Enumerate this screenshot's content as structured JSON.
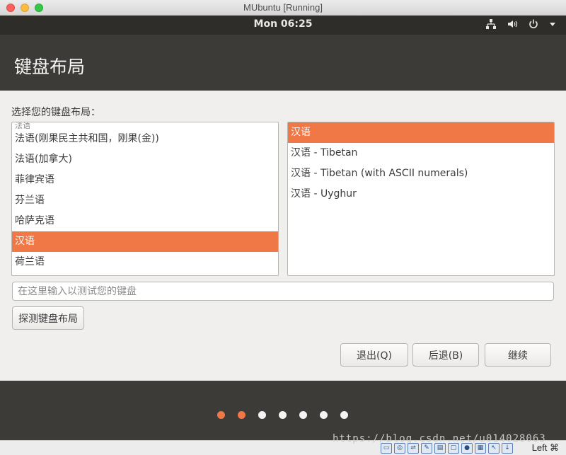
{
  "window": {
    "title": "MUbuntu [Running]"
  },
  "panel": {
    "clock": "Mon 06:25",
    "icons": [
      "network-icon",
      "volume-icon",
      "power-icon",
      "menu-arrow-icon"
    ]
  },
  "installer": {
    "title": "键盘布局",
    "prompt": "选择您的键盘布局：",
    "layouts": [
      {
        "label": "法语",
        "partial": true,
        "selected": false
      },
      {
        "label": "法语(刚果民主共和国，刚果(金))",
        "selected": false
      },
      {
        "label": "法语(加拿大)",
        "selected": false
      },
      {
        "label": "菲律宾语",
        "selected": false
      },
      {
        "label": "芬兰语",
        "selected": false
      },
      {
        "label": "哈萨克语",
        "selected": false
      },
      {
        "label": "汉语",
        "selected": true
      },
      {
        "label": "荷兰语",
        "selected": false
      }
    ],
    "variants": [
      {
        "label": "汉语",
        "selected": true
      },
      {
        "label": "汉语 - Tibetan",
        "selected": false
      },
      {
        "label": "汉语 - Tibetan (with ASCII numerals)",
        "selected": false
      },
      {
        "label": "汉语 - Uyghur",
        "selected": false
      }
    ],
    "test_input": {
      "placeholder": "在这里输入以测试您的键盘",
      "value": ""
    },
    "buttons": {
      "detect": "探测键盘布局",
      "quit": "退出(Q)",
      "back": "后退(B)",
      "continue": "继续"
    },
    "steps": {
      "total": 7,
      "completed": 2
    }
  },
  "statusbar": {
    "watermark": "https://blog.csdn.net/u014028063",
    "host_key": "Left ⌘",
    "icons": [
      "hard-disk-icon",
      "optical-drive-icon",
      "usb-icon",
      "pencil-icon",
      "folder-icon",
      "display-icon",
      "recording-icon",
      "cpu-icon",
      "mouse-integration-icon",
      "download-icon"
    ]
  },
  "colors": {
    "accent": "#f07746",
    "header_bg": "#3c3b37",
    "content_bg": "#f0efed"
  }
}
